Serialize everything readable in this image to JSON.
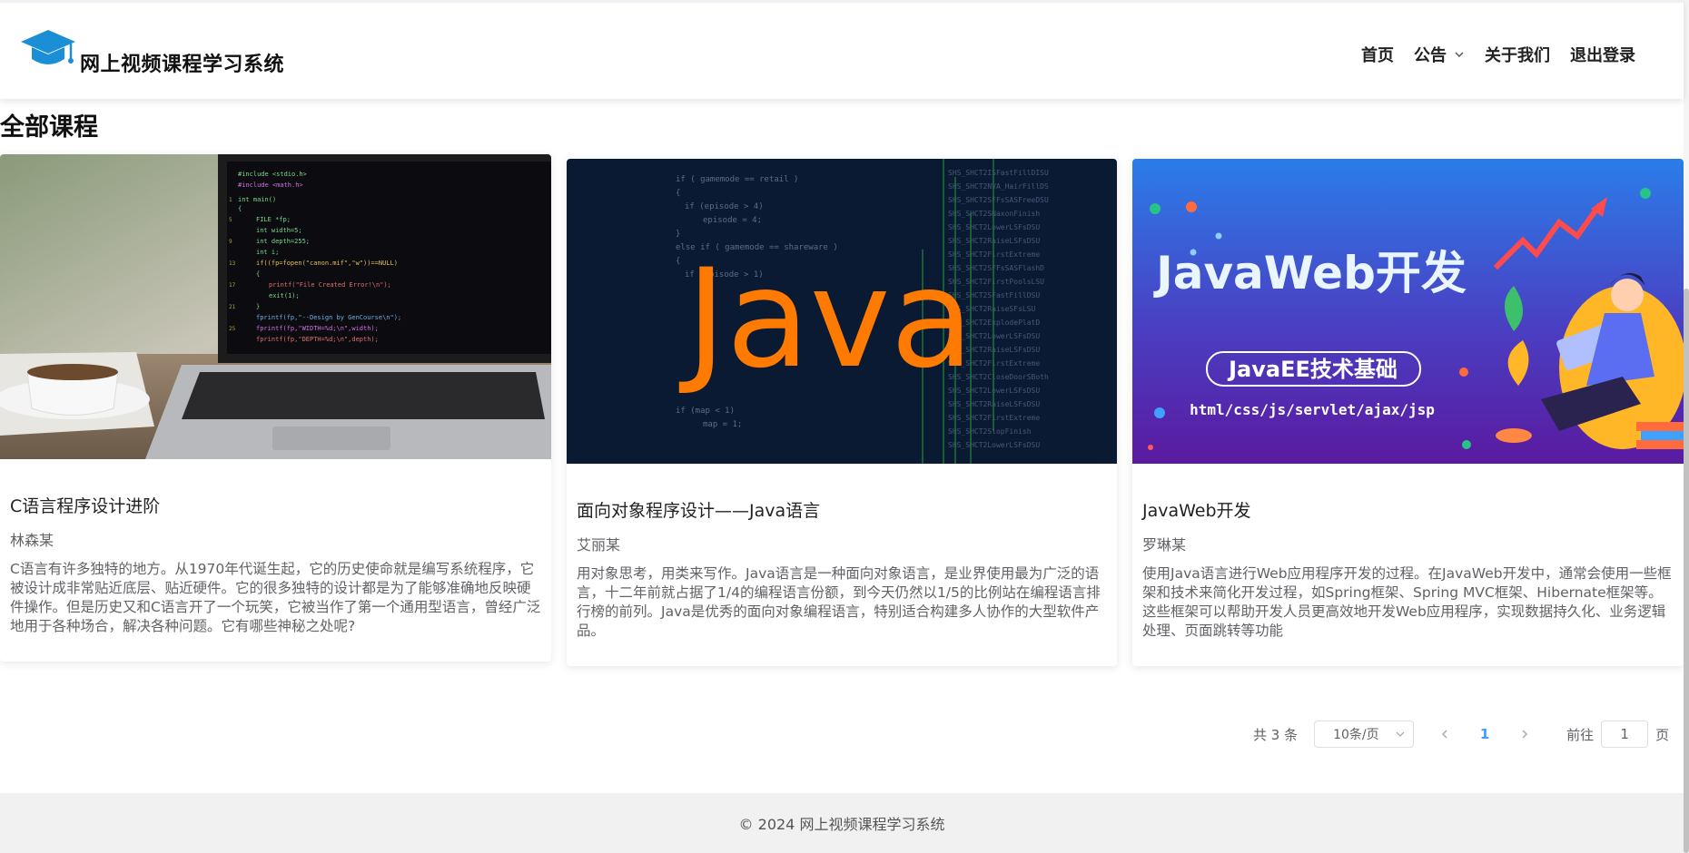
{
  "header": {
    "site_title": "网上视频课程学习系统",
    "nav": {
      "home": "首页",
      "notice": "公告",
      "about": "关于我们",
      "logout": "退出登录"
    }
  },
  "main": {
    "page_title": "全部课程",
    "courses": [
      {
        "title": "C语言程序设计进阶",
        "author": "林森某",
        "description": "C语言有许多独特的地方。从1970年代诞生起，它的历史使命就是编写系统程序，它被设计成非常贴近底层、贴近硬件。它的很多独特的设计都是为了能够准确地反映硬件操作。但是历史又和C语言开了一个玩笑，它被当作了第一个通用型语言，曾经广泛地用于各种场合，解决各种问题。它有哪些神秘之处呢?",
        "thumbnail": "laptop with code and coffee cup"
      },
      {
        "title": "面向对象程序设计——Java语言",
        "author": "艾丽某",
        "description": "用对象思考，用类来写作。Java语言是一种面向对象语言，是业界使用最为广泛的语言，十二年前就占据了1/4的编程语言份额，到今天仍然以1/5的比例站在编程语言排行榜的前列。Java是优秀的面向对象编程语言，特别适合构建多人协作的大型软件产品。",
        "thumbnail_text": "Java"
      },
      {
        "title": "JavaWeb开发",
        "author": "罗琳某",
        "description": "使用Java语言进行Web应用程序开发的过程。在JavaWeb开发中，通常会使用一些框架和技术来简化开发过程，如Spring框架、Spring MVC框架、Hibernate框架等。这些框架可以帮助开发人员更高效地开发Web应用程序，实现数据持久化、业务逻辑处理、页面跳转等功能",
        "thumbnail_title": "JavaWeb开发",
        "thumbnail_badge": "JavaEE技术基础",
        "thumbnail_sub": "html/css/js/servlet/ajax/jsp"
      }
    ]
  },
  "pagination": {
    "total": "共 3 条",
    "page_size": "10条/页",
    "current_page": "1",
    "goto_prefix": "前往",
    "goto_value": "1",
    "goto_suffix": "页"
  },
  "footer": {
    "copyright": "© 2024 网上视频课程学习系统"
  },
  "colors": {
    "accent": "#409eff",
    "java_orange": "#ff7a00",
    "javaweb_blue": "#2b6de3",
    "javaweb_purple": "#5b1fa6"
  }
}
